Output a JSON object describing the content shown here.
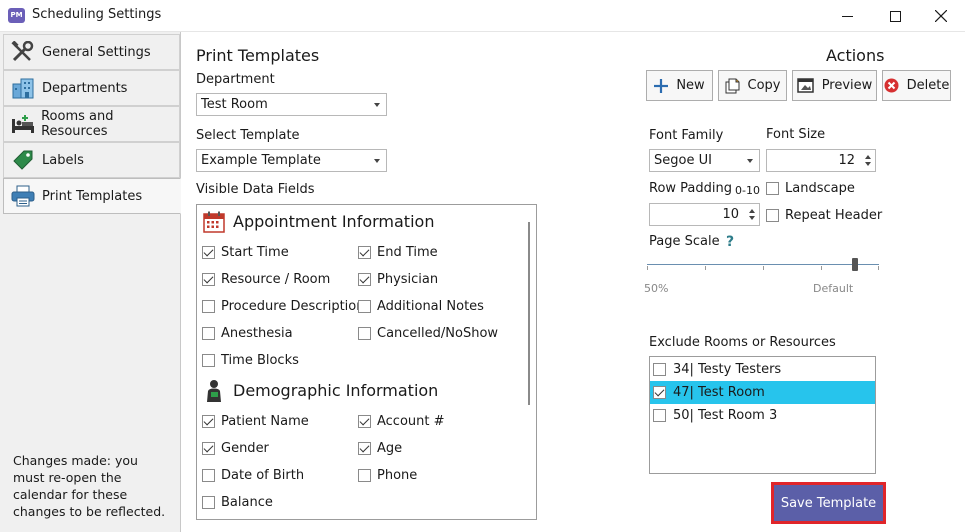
{
  "window": {
    "title": "Scheduling Settings",
    "app_icon_text": "PM"
  },
  "sidebar": {
    "items": [
      {
        "label": "General Settings",
        "icon": "tools-icon"
      },
      {
        "label": "Departments",
        "icon": "building-icon"
      },
      {
        "label": "Rooms and Resources",
        "icon": "bed-icon"
      },
      {
        "label": "Labels",
        "icon": "tag-icon"
      },
      {
        "label": "Print Templates",
        "icon": "printer-icon"
      }
    ],
    "active_index": 4,
    "note": "Changes made: you must re-open the calendar for these changes to be reflected."
  },
  "print_templates": {
    "heading": "Print Templates",
    "department_label": "Department",
    "department_value": "Test Room",
    "select_template_label": "Select Template",
    "template_value": "Example Template",
    "visible_fields_label": "Visible Data Fields",
    "appointment_section": {
      "title": "Appointment Information",
      "fields": [
        {
          "label": "Start Time",
          "checked": true
        },
        {
          "label": "End Time",
          "checked": true
        },
        {
          "label": "Resource / Room",
          "checked": true
        },
        {
          "label": "Physician",
          "checked": true
        },
        {
          "label": "Procedure Description",
          "checked": false
        },
        {
          "label": "Additional Notes",
          "checked": false
        },
        {
          "label": "Anesthesia",
          "checked": false
        },
        {
          "label": "Cancelled/NoShow",
          "checked": false
        },
        {
          "label": "Time Blocks",
          "checked": false
        }
      ]
    },
    "demographic_section": {
      "title": "Demographic Information",
      "fields": [
        {
          "label": "Patient Name",
          "checked": true
        },
        {
          "label": "Account #",
          "checked": true
        },
        {
          "label": "Gender",
          "checked": true
        },
        {
          "label": "Age",
          "checked": true
        },
        {
          "label": "Date of Birth",
          "checked": false
        },
        {
          "label": "Phone",
          "checked": false
        },
        {
          "label": "Balance",
          "checked": false
        }
      ]
    }
  },
  "actions": {
    "heading": "Actions",
    "new_label": "New",
    "copy_label": "Copy",
    "preview_label": "Preview",
    "delete_label": "Delete",
    "font_family_label": "Font Family",
    "font_family_value": "Segoe UI",
    "font_size_label": "Font Size",
    "font_size_value": "12",
    "row_padding_label": "Row Padding",
    "row_padding_range": "0-10",
    "row_padding_value": "10",
    "landscape_label": "Landscape",
    "landscape_checked": false,
    "repeat_header_label": "Repeat Header",
    "repeat_header_checked": false,
    "page_scale_label": "Page Scale",
    "page_scale_help": "?",
    "scale_min_label": "50%",
    "scale_default_label": "Default",
    "exclude_label": "Exclude Rooms or Resources",
    "rooms": [
      {
        "label": "34| Testy Testers",
        "checked": false,
        "selected": false
      },
      {
        "label": "47| Test Room",
        "checked": true,
        "selected": true
      },
      {
        "label": "50| Test Room 3",
        "checked": false,
        "selected": false
      }
    ],
    "save_label": "Save Template"
  },
  "colors": {
    "save_border": "#e0252a",
    "save_bg": "#5b5fa8",
    "selection": "#27c4ec"
  }
}
